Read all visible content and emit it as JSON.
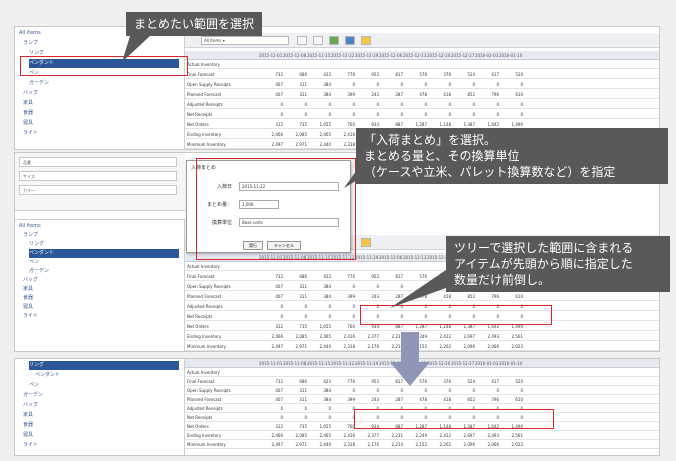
{
  "callouts": {
    "select_range": "まとめたい範囲を選択",
    "choose_line1": "「入荷まとめ」を選択。",
    "choose_line2": "まとめる量と、その換算単位",
    "choose_line3": "（ケースや立米、パレット換算数など）を指定",
    "tree_line1": "ツリーで選択した範囲に含まれる",
    "tree_line2": "アイテムが先頭から順に指定した",
    "tree_line3": "数量だけ前倒し。"
  },
  "tree": {
    "items": [
      "All Items",
      "ランプ",
      "リング",
      "ペンダント",
      "ペン",
      "ガーデン",
      "バッグ",
      "家具",
      "食器",
      "寝具",
      "ライト"
    ]
  },
  "toolbar": {
    "selector": "All Items ▾"
  },
  "grid": {
    "columns": [
      "2015-11-01",
      "2015-11-08",
      "2015-11-15",
      "2015-11-22",
      "2015-11-29",
      "2015-12-06",
      "2015-12-13",
      "2015-12-20",
      "2015-12-27",
      "2016-01-03",
      "2016-01-10"
    ],
    "row_labels": [
      "Actual Inventory",
      "Final Forecast",
      "Open Supply Receipts",
      "Planned Forecast",
      "Adjusted Receipts",
      "Net Receipts",
      "Net Orders",
      "Ending Inventory",
      "Minimum Inventory"
    ],
    "rows": [
      [
        "",
        "",
        "",
        "",
        "",
        "",
        "",
        "",
        "",
        "",
        ""
      ],
      [
        "732",
        "686",
        "423",
        "776",
        "953",
        "817",
        "576",
        "376",
        "524",
        "417",
        "520"
      ],
      [
        "407",
        "311",
        "384",
        "0",
        "0",
        "0",
        "0",
        "0",
        "0",
        "0",
        "0"
      ],
      [
        "407",
        "311",
        "384",
        "399",
        "243",
        "287",
        "478",
        "418",
        "852",
        "796",
        "610"
      ],
      [
        "0",
        "0",
        "0",
        "0",
        "0",
        "0",
        "0",
        "0",
        "0",
        "0",
        "0"
      ],
      [
        "0",
        "0",
        "0",
        "0",
        "0",
        "0",
        "0",
        "0",
        "0",
        "0",
        "0"
      ],
      [
        "312",
        "735",
        "1,055",
        "760",
        "934",
        "887",
        "1,287",
        "1,148",
        "1,387",
        "1,642",
        "1,490"
      ],
      [
        "2,466",
        "2,085",
        "2,465",
        "2,416",
        "2,377",
        "2,231",
        "2,249",
        "2,412",
        "2,697",
        "2,493",
        "2,561"
      ],
      [
        "2,497",
        "2,971",
        "2,440",
        "2,318",
        "2,176",
        "2,214",
        "2,152",
        "2,202",
        "2,096",
        "2,066",
        "2,023"
      ]
    ]
  },
  "dialog": {
    "title": "入荷まとめ",
    "label_type": "入荷日",
    "value_type": "2015-11-22",
    "label_qty": "まとめ量：",
    "value_qty": "1,000",
    "label_unit": "換算単位",
    "value_unit": "Base units",
    "ok": "実行",
    "cancel": "キャンセル"
  },
  "filters": {
    "f1": "品番",
    "f2": "サイズ",
    "f3": "カラー"
  }
}
